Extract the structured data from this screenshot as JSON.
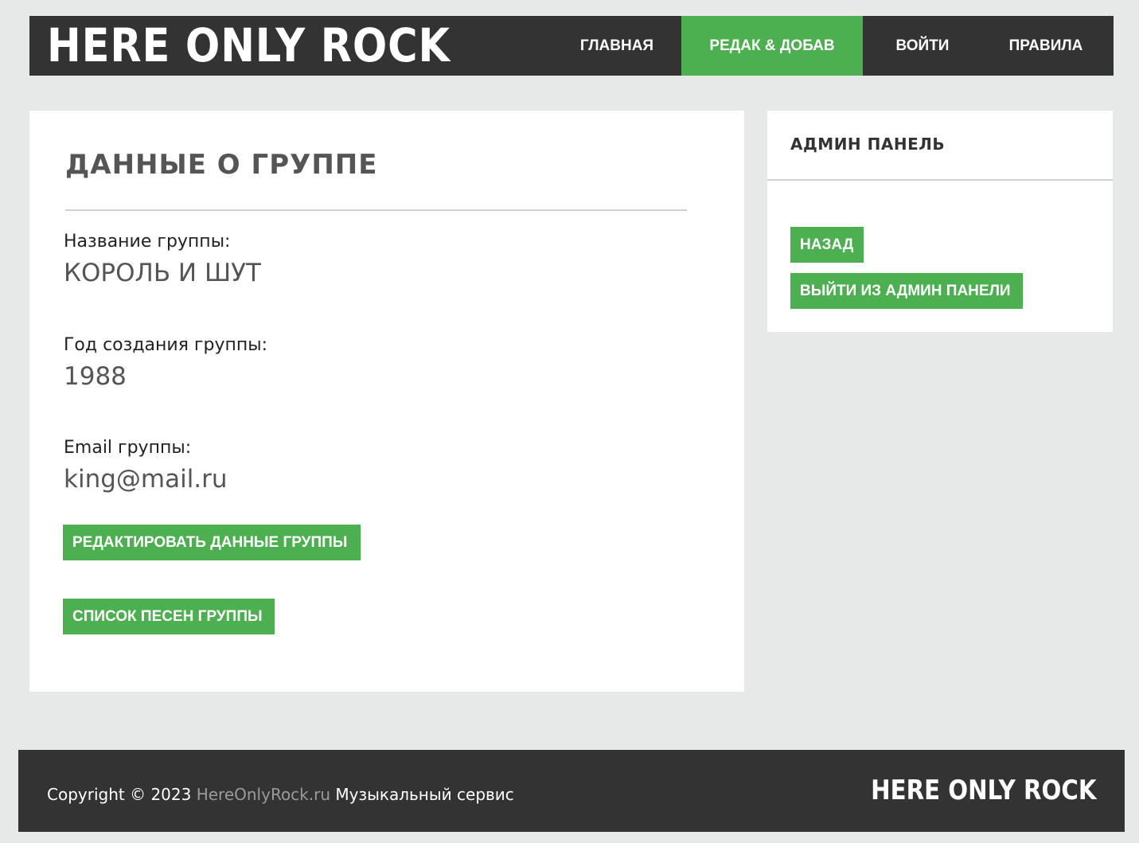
{
  "header": {
    "logo": "HERE ONLY ROCK",
    "nav": {
      "home": "ГЛАВНАЯ",
      "edit_add": "РЕДАК & ДОБАВ",
      "login": "ВОЙТИ",
      "rules": "ПРАВИЛА"
    },
    "active_tab": "edit_add"
  },
  "main": {
    "title": "ДАННЫЕ О ГРУППЕ",
    "fields": {
      "name_label": "Название группы:",
      "name_value": "КОРОЛЬ И ШУТ",
      "year_label": "Год создания группы:",
      "year_value": "1988",
      "email_label": "Email группы:",
      "email_value": "king@mail.ru"
    },
    "buttons": {
      "edit": "РЕДАКТИРОВАТЬ ДАННЫЕ ГРУППЫ",
      "songs": "СПИСОК ПЕСЕН ГРУППЫ"
    }
  },
  "sidebar": {
    "title": "АДМИН ПАНЕЛЬ",
    "buttons": {
      "back": "НАЗАД",
      "exit": "ВЫЙТИ ИЗ АДМИН ПАНЕЛИ"
    }
  },
  "footer": {
    "copyright": "Copyright © 2023",
    "site_link": "HereOnlyRock.ru",
    "tagline": "Музыкальный сервис",
    "logo": "HERE ONLY ROCK"
  },
  "colors": {
    "accent": "#4caf50",
    "dark": "#333333",
    "background": "#e7e9e8"
  }
}
